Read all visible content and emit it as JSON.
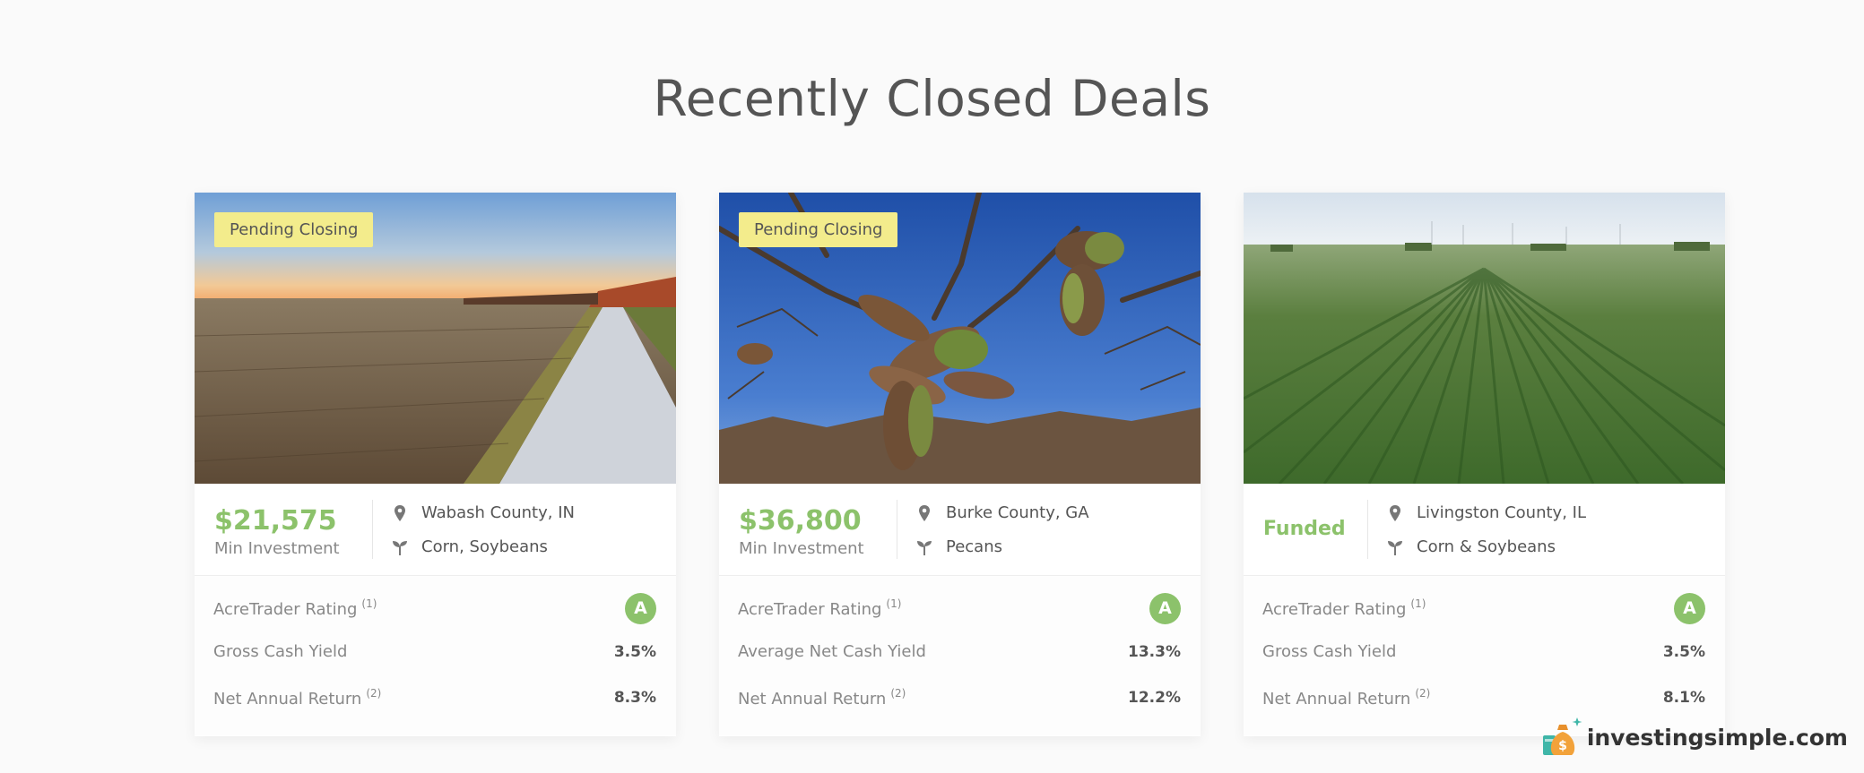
{
  "page": {
    "title": "Recently Closed Deals"
  },
  "deals": [
    {
      "badge": "Pending Closing",
      "price": "$21,575",
      "price_label": "Min Investment",
      "location": "Wabash County, IN",
      "crops": "Corn, Soybeans",
      "stats": [
        {
          "label": "AcreTrader Rating",
          "note": "(1)",
          "value": "A"
        },
        {
          "label": "Gross Cash Yield",
          "note": "",
          "value": "3.5%"
        },
        {
          "label": "Net Annual Return",
          "note": "(2)",
          "value": "8.3%"
        }
      ]
    },
    {
      "badge": "Pending Closing",
      "price": "$36,800",
      "price_label": "Min Investment",
      "location": "Burke County, GA",
      "crops": "Pecans",
      "stats": [
        {
          "label": "AcreTrader Rating",
          "note": "(1)",
          "value": "A"
        },
        {
          "label": "Average Net Cash Yield",
          "note": "",
          "value": "13.3%"
        },
        {
          "label": "Net Annual Return",
          "note": "(2)",
          "value": "12.2%"
        }
      ]
    },
    {
      "badge": "",
      "status": "Funded",
      "location": "Livingston County, IL",
      "crops": "Corn & Soybeans",
      "stats": [
        {
          "label": "AcreTrader Rating",
          "note": "(1)",
          "value": "A"
        },
        {
          "label": "Gross Cash Yield",
          "note": "",
          "value": "3.5%"
        },
        {
          "label": "Net Annual Return",
          "note": "(2)",
          "value": "8.1%"
        }
      ]
    }
  ],
  "watermark": {
    "text": "investingsimple.com"
  },
  "colors": {
    "accent": "#8cc26b",
    "badge": "#f3ec8c",
    "text": "#555555"
  },
  "icons": {
    "location": "map-pin-icon",
    "crop": "sprout-icon"
  }
}
